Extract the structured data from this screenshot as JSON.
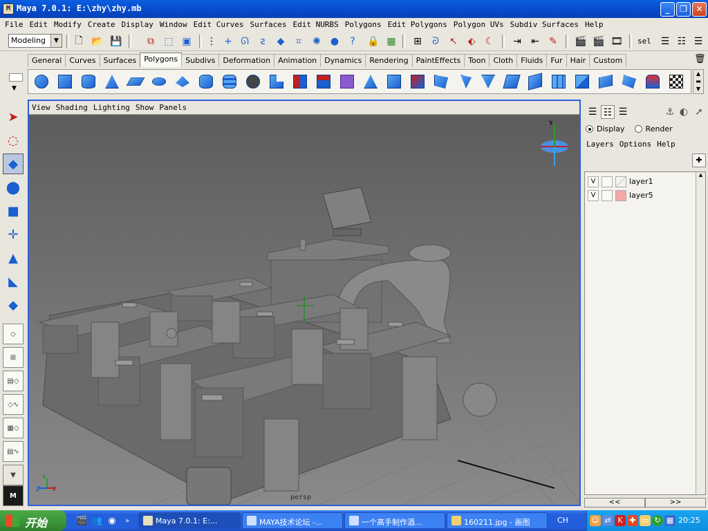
{
  "window": {
    "title": "Maya 7.0.1: E:\\zhy\\zhy.mb",
    "app_icon": "M"
  },
  "menubar": [
    "File",
    "Edit",
    "Modify",
    "Create",
    "Display",
    "Window",
    "Edit Curves",
    "Surfaces",
    "Edit NURBS",
    "Polygons",
    "Edit Polygons",
    "Polygon UVs",
    "Subdiv Surfaces",
    "Help"
  ],
  "status_line": {
    "mode": "Modeling",
    "sel_label": "sel"
  },
  "shelf_tabs": [
    "General",
    "Curves",
    "Surfaces",
    "Polygons",
    "Subdivs",
    "Deformation",
    "Animation",
    "Dynamics",
    "Rendering",
    "PaintEffects",
    "Toon",
    "Cloth",
    "Fluids",
    "Fur",
    "Hair",
    "Custom"
  ],
  "active_shelf_tab": "Polygons",
  "viewport": {
    "menu": [
      "View",
      "Shading",
      "Lighting",
      "Show",
      "Panels"
    ],
    "camera": "persp",
    "axis_labels": {
      "y": "Y",
      "z": "Z",
      "x": "X"
    }
  },
  "layer_editor": {
    "modes": [
      {
        "label": "Display",
        "selected": true
      },
      {
        "label": "Render",
        "selected": false
      }
    ],
    "menu": [
      "Layers",
      "Options",
      "Help"
    ],
    "layers": [
      {
        "visible": "V",
        "name": "layer1",
        "color": "#f4f3ee"
      },
      {
        "visible": "V",
        "name": "layer5",
        "color": "#f4a8a8"
      }
    ],
    "scroll_left": "<<",
    "scroll_right": ">>"
  },
  "taskbar": {
    "start_label": "开始",
    "tasks": [
      {
        "label": "Maya 7.0.1: E:..."
      },
      {
        "label": "MAYA技术论坛 -..."
      },
      {
        "label": "一个高手制作酒..."
      },
      {
        "label": "160211.jpg - 画图"
      }
    ],
    "language": "CH",
    "clock": "20:25"
  },
  "colors": {
    "viewport_bg": "#6f6f6f",
    "active_panel_border": "#2f5fd8",
    "ui_bg": "#e8e6dd",
    "taskbar": "#245edb"
  }
}
